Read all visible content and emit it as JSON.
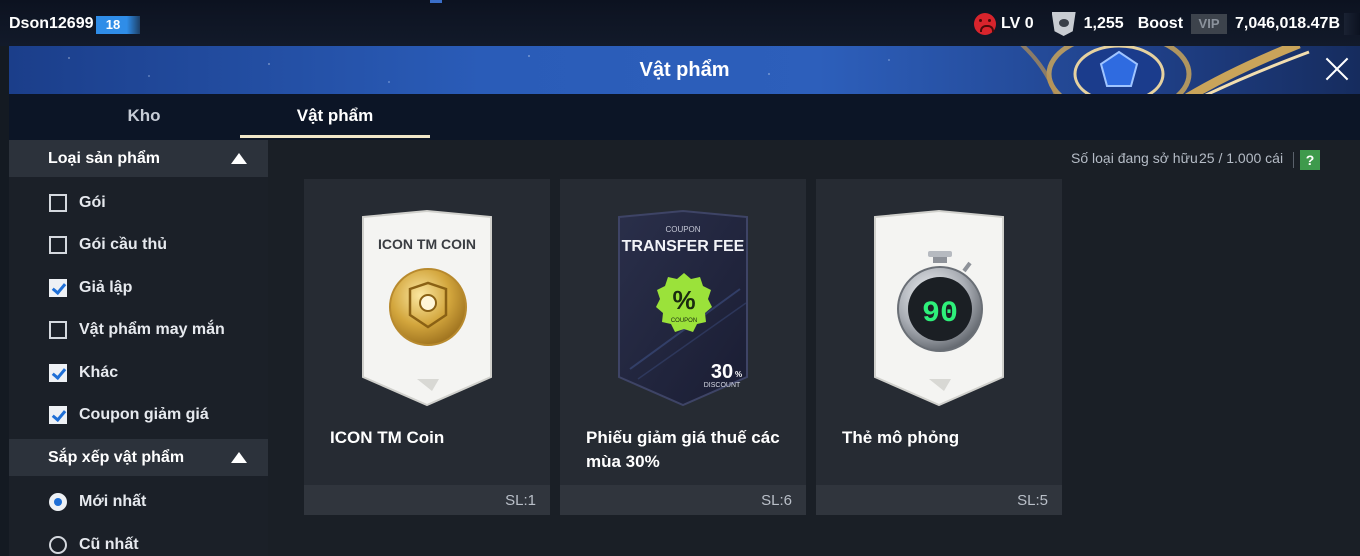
{
  "status": {
    "username": "Dson12699",
    "level_badge": "18",
    "lv": "LV 0",
    "coins": "1,255",
    "boost": "Boost",
    "vip": "VIP",
    "money": "7,046,018.47B"
  },
  "header": {
    "title": "Vật phẩm"
  },
  "tabs": [
    {
      "label": "Kho",
      "active": false
    },
    {
      "label": "Vật phẩm",
      "active": true
    }
  ],
  "sidebar": {
    "product_type": {
      "title": "Loại sản phẩm",
      "options": [
        {
          "label": "Gói",
          "checked": false
        },
        {
          "label": "Gói cầu thủ",
          "checked": false
        },
        {
          "label": "Giả lập",
          "checked": true
        },
        {
          "label": "Vật phẩm may mắn",
          "checked": false
        },
        {
          "label": "Khác",
          "checked": true
        },
        {
          "label": "Coupon giảm giá",
          "checked": true
        }
      ]
    },
    "sort": {
      "title": "Sắp xếp vật phẩm",
      "options": [
        {
          "label": "Mới nhất",
          "selected": true
        },
        {
          "label": "Cũ nhất",
          "selected": false
        }
      ]
    }
  },
  "main": {
    "owned_label": "Số loại đang sở hữu",
    "owned_count": "25 / 1.000 cái",
    "help": "?",
    "items": [
      {
        "name": "ICON TM Coin",
        "qty": "SL:1",
        "card_text": "ICON TM COIN",
        "icon": "gold-coin-icon"
      },
      {
        "name": "Phiếu giảm giá thuế các mùa 30%",
        "qty": "SL:6",
        "card_small": "COUPON",
        "card_text": "TRANSFER FEE",
        "badge": "%",
        "badge_sub": "COUPON",
        "discount": "30",
        "discount_unit": "%",
        "discount_label": "DISCOUNT",
        "icon": "coupon-icon"
      },
      {
        "name": "Thẻ mô phỏng",
        "qty": "SL:5",
        "timer": "90",
        "icon": "stopwatch-icon"
      }
    ]
  },
  "colors": {
    "accent_blue": "#1f6fd6",
    "banner": "#2a5cb8",
    "help_green": "#3e9a4c",
    "coupon_green": "#9be23a"
  }
}
